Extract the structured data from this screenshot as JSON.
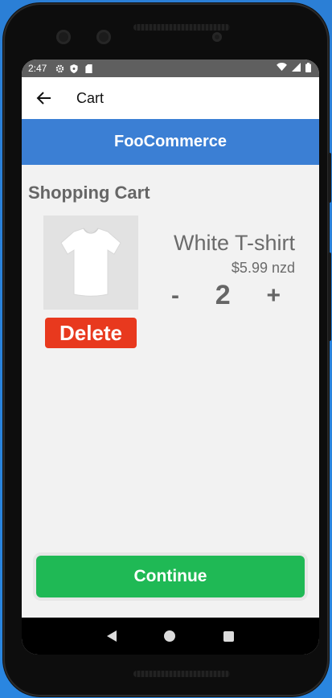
{
  "status_bar": {
    "time": "2:47",
    "icons": [
      "settings-icon",
      "shield-icon",
      "sd-card-icon",
      "wifi-icon",
      "signal-icon",
      "battery-icon"
    ]
  },
  "app_bar": {
    "title": "Cart",
    "back_icon": "arrow-left-icon"
  },
  "brand": {
    "name": "FooCommerce",
    "color": "#3b7fd4"
  },
  "page": {
    "heading": "Shopping Cart"
  },
  "cart": {
    "items": [
      {
        "name": "White T-shirt",
        "price": "$5.99 nzd",
        "quantity": "2",
        "decrement_label": "-",
        "increment_label": "+",
        "delete_label": "Delete",
        "image_icon": "tshirt-image"
      }
    ]
  },
  "footer": {
    "continue_label": "Continue",
    "continue_color": "#1fb955"
  },
  "colors": {
    "delete": "#e8391e",
    "status_bar": "#5f5f5f"
  },
  "nav": {
    "back_icon": "nav-back-icon",
    "home_icon": "nav-home-icon",
    "recents_icon": "nav-recents-icon"
  }
}
